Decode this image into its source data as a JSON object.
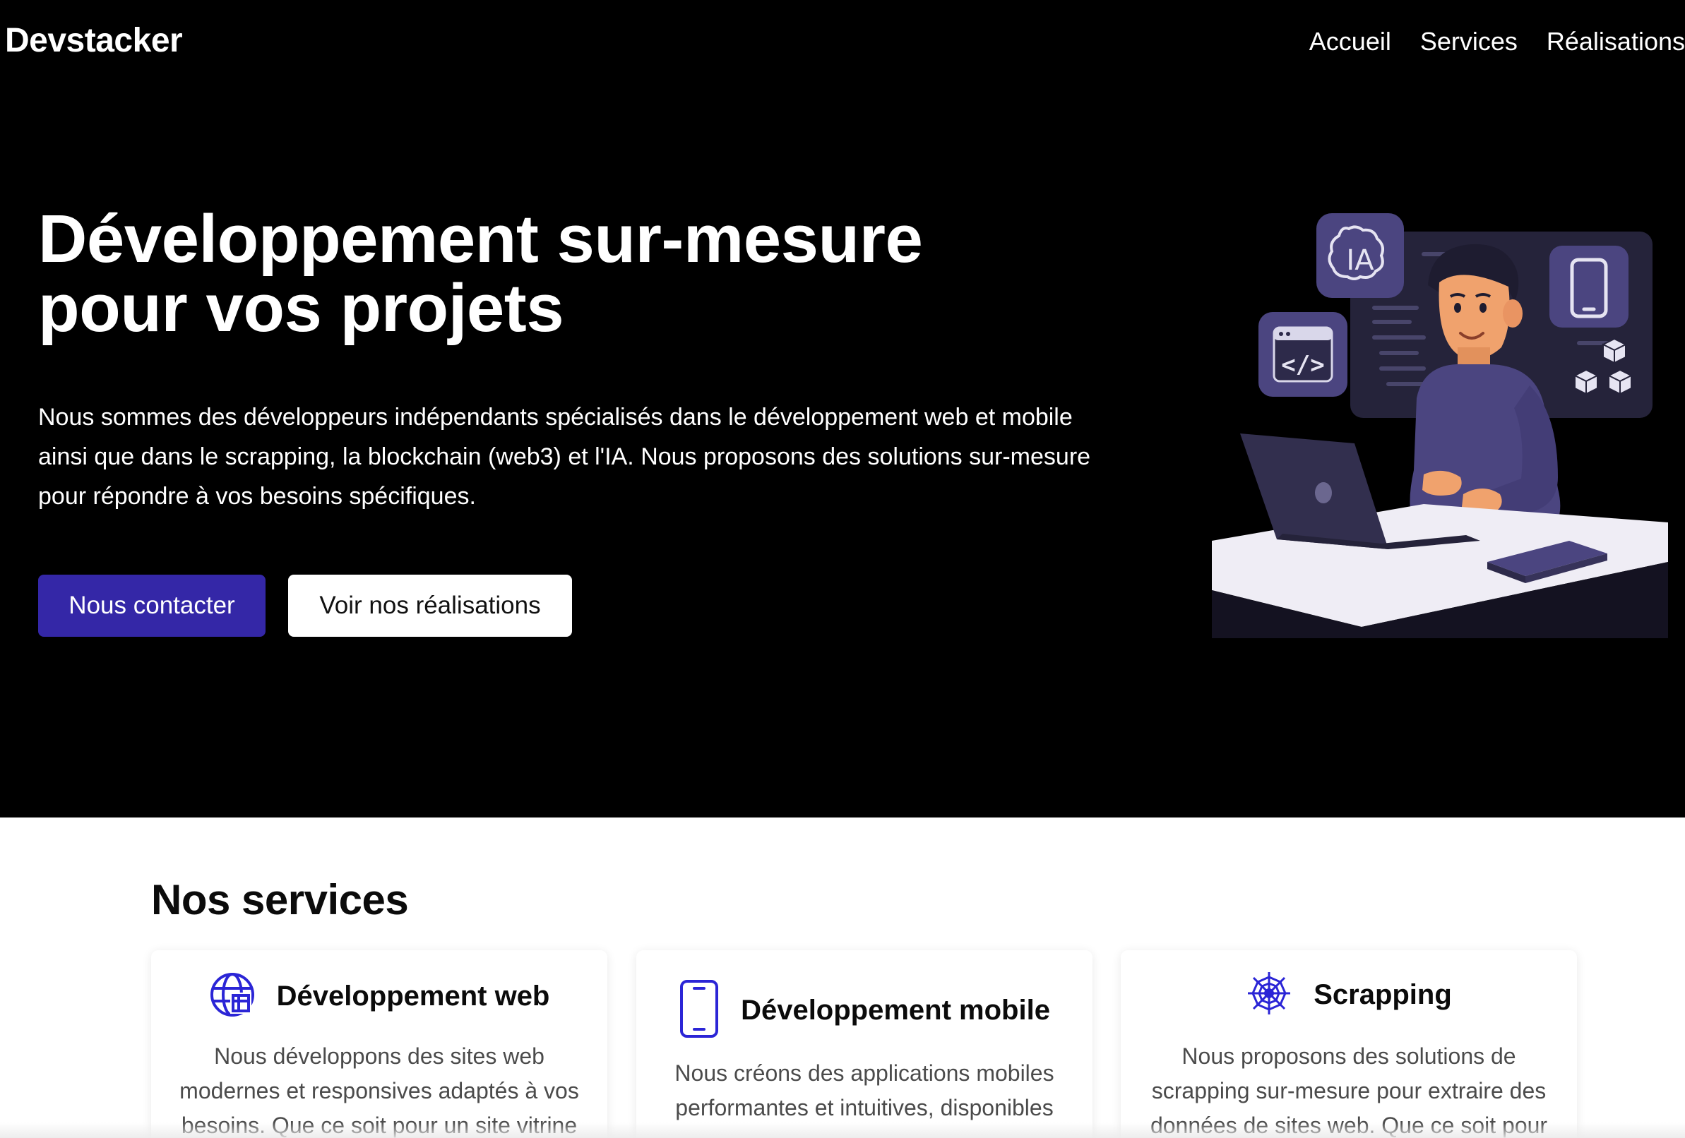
{
  "header": {
    "brand": "Devstacker",
    "nav": [
      "Accueil",
      "Services",
      "Réalisations"
    ]
  },
  "hero": {
    "title_line1": "Développement sur-mesure",
    "title_line2": "pour vos projets",
    "description": "Nous sommes des développeurs indépendants spécialisés dans le développement web et mobile ainsi que dans le scrapping, la blockchain (web3) et l'IA. Nous proposons des solutions sur-mesure pour répondre à vos besoins spécifiques.",
    "primary_button": "Nous contacter",
    "secondary_button": "Voir nos réalisations",
    "illustration_badge": "IA"
  },
  "services": {
    "title": "Nos services",
    "cards": [
      {
        "icon": "globe-icon",
        "title": "Développement web",
        "text": "Nous développons des sites web modernes et responsives adaptés à vos besoins. Que ce soit pour un site vitrine"
      },
      {
        "icon": "smartphone-icon",
        "title": "Développement mobile",
        "text": "Nous créons des applications mobiles performantes et intuitives, disponibles"
      },
      {
        "icon": "spider-web-icon",
        "title": "Scrapping",
        "text": "Nous proposons des solutions de scrapping sur-mesure pour extraire des données de sites web. Que ce soit pour"
      }
    ]
  },
  "colors": {
    "hero_background": "#000000",
    "primary": "#3427a7",
    "accent_icon": "#2b25d6",
    "illustration_purple": "#4b4580"
  }
}
